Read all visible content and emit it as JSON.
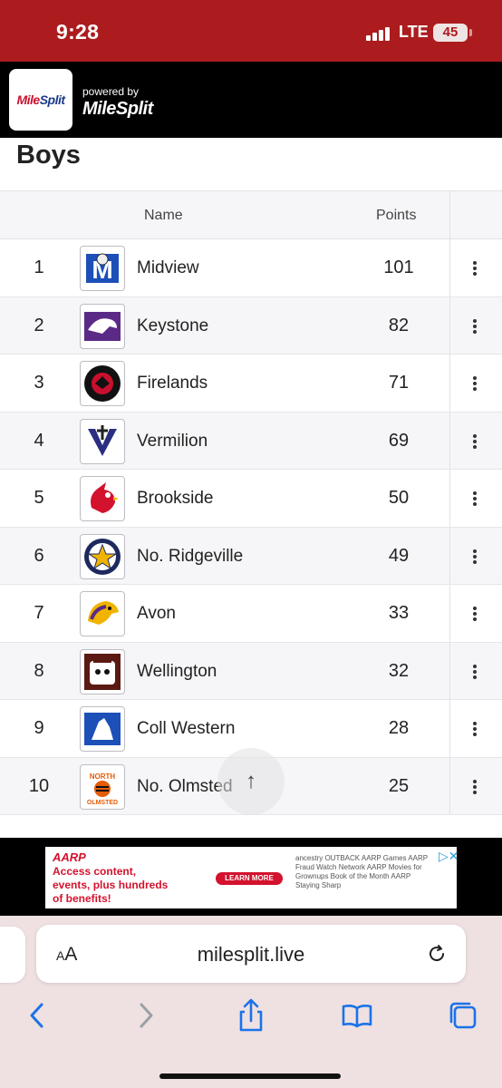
{
  "status_bar": {
    "time": "9:28",
    "network": "LTE",
    "battery": "45"
  },
  "header": {
    "logo_text_1": "Mile",
    "logo_text_2": "Split",
    "powered_by": "powered by",
    "brand": "MileSplit"
  },
  "section_title": "Boys",
  "table": {
    "columns": {
      "name": "Name",
      "points": "Points"
    },
    "rows": [
      {
        "rank": "1",
        "team": "Midview",
        "points": "101",
        "logo": "midview-logo"
      },
      {
        "rank": "2",
        "team": "Keystone",
        "points": "82",
        "logo": "keystone-logo"
      },
      {
        "rank": "3",
        "team": "Firelands",
        "points": "71",
        "logo": "firelands-logo"
      },
      {
        "rank": "4",
        "team": "Vermilion",
        "points": "69",
        "logo": "vermilion-logo"
      },
      {
        "rank": "5",
        "team": "Brookside",
        "points": "50",
        "logo": "brookside-logo"
      },
      {
        "rank": "6",
        "team": "No. Ridgeville",
        "points": "49",
        "logo": "no-ridgeville-logo"
      },
      {
        "rank": "7",
        "team": "Avon",
        "points": "33",
        "logo": "avon-logo"
      },
      {
        "rank": "8",
        "team": "Wellington",
        "points": "32",
        "logo": "wellington-logo"
      },
      {
        "rank": "9",
        "team": "Coll Western",
        "points": "28",
        "logo": "coll-western-logo"
      },
      {
        "rank": "10",
        "team": "No. Olmsted",
        "points": "25",
        "logo": "no-olmsted-logo"
      }
    ]
  },
  "ad": {
    "advertiser": "AARP",
    "text": "Access content, events, plus hundreds of benefits!",
    "button": "LEARN MORE",
    "partners": "ancestry OUTBACK AARP Games AARP Fraud Watch Network AARP Movies for Grownups Book of the Month AARP Staying Sharp"
  },
  "browser": {
    "url": "milesplit.live",
    "text_size_label_small": "A",
    "text_size_label_large": "A"
  },
  "colors": {
    "status_bar": "#ac1c1e",
    "header": "#000000",
    "safari_bg": "#efe0e2",
    "accent_blue": "#1a73e8"
  }
}
